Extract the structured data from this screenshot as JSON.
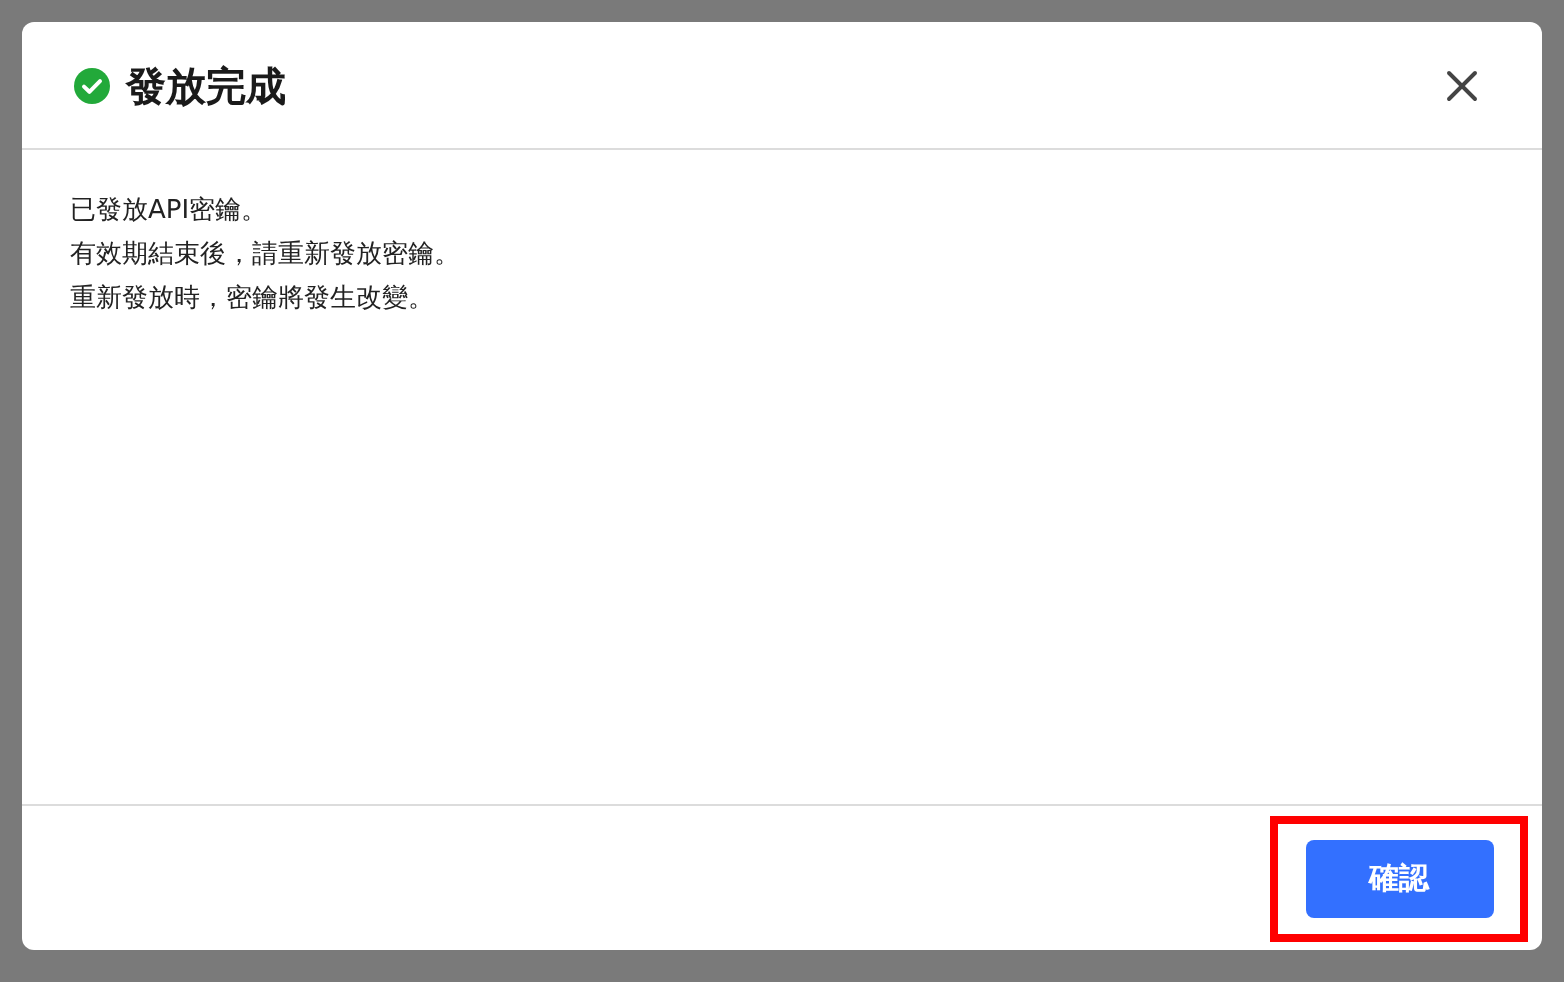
{
  "dialog": {
    "title": "發放完成",
    "succeeded": true,
    "message_lines": [
      "已發放API密鑰。",
      "有效期結束後，請重新發放密鑰。",
      "重新發放時，密鑰將發生改變。"
    ],
    "confirm_button": {
      "label": "確認",
      "highlighted": true
    }
  }
}
